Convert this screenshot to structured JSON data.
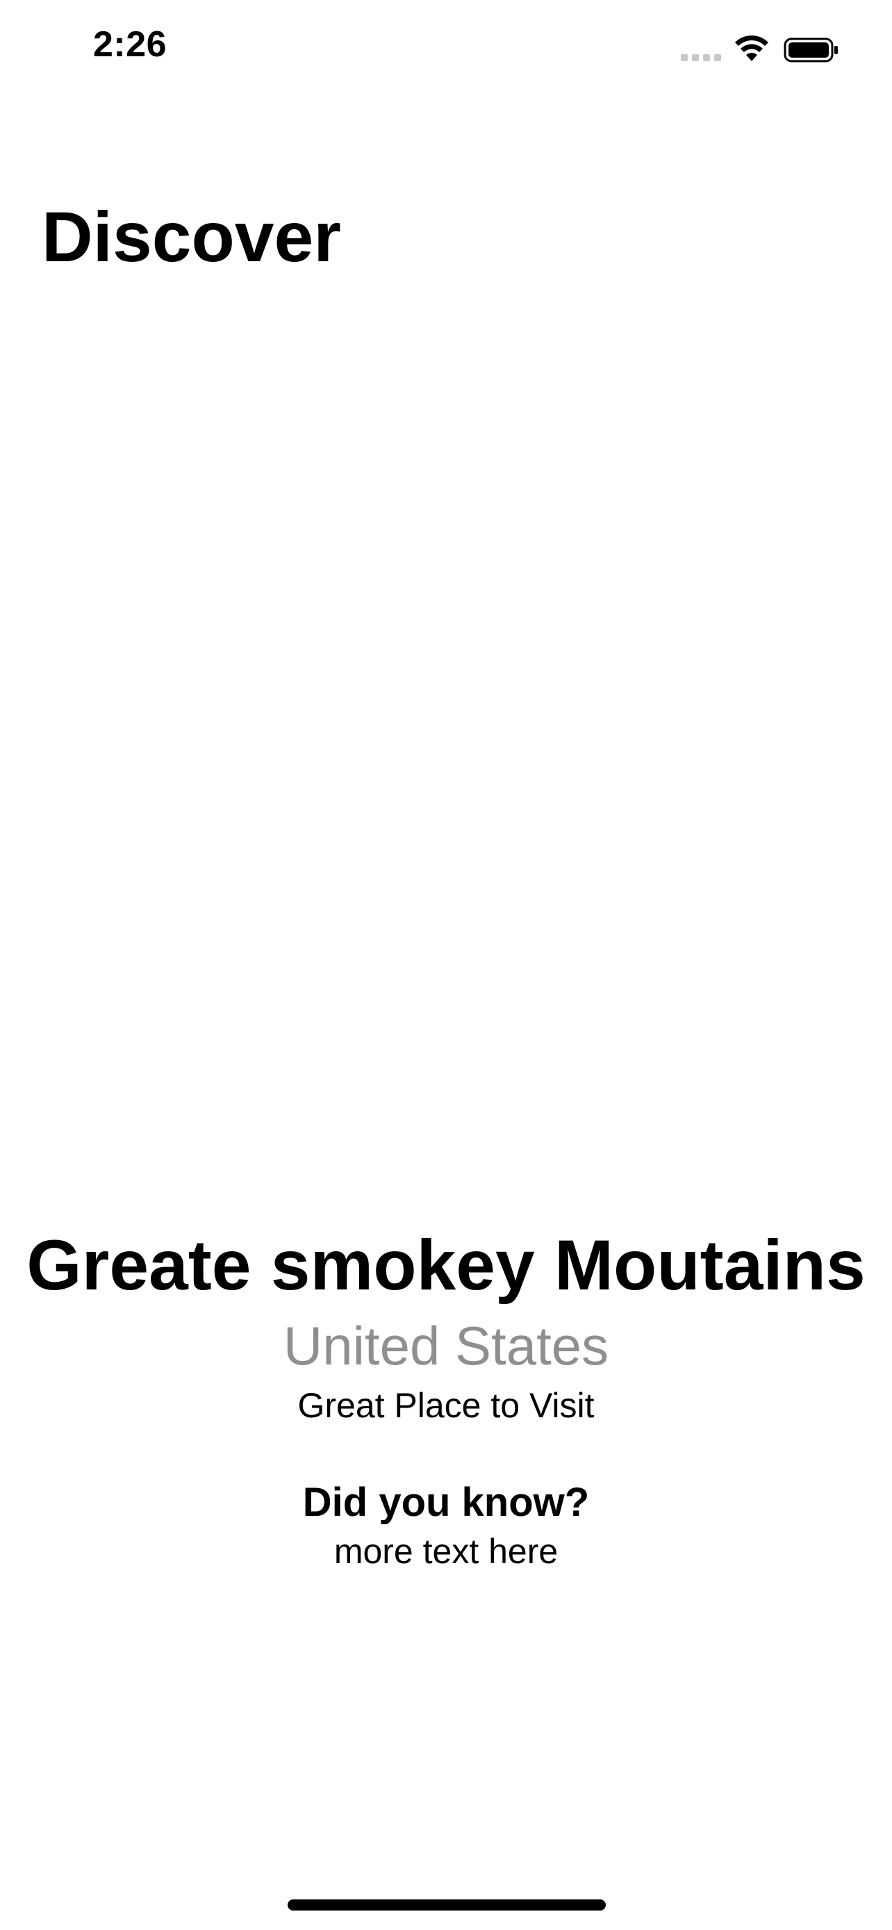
{
  "status_bar": {
    "time": "2:26",
    "icons": [
      "cellular-signal-icon",
      "wifi-icon",
      "battery-icon"
    ]
  },
  "header": {
    "title": "Discover"
  },
  "place": {
    "name": "Greate smokey Moutains",
    "country": "United States",
    "tagline": "Great Place to Visit",
    "fact_heading": "Did you know?",
    "fact_body": "more text here"
  },
  "colors": {
    "background": "#ffffff",
    "primary_text": "#000000",
    "secondary_text": "#8e8e93"
  }
}
